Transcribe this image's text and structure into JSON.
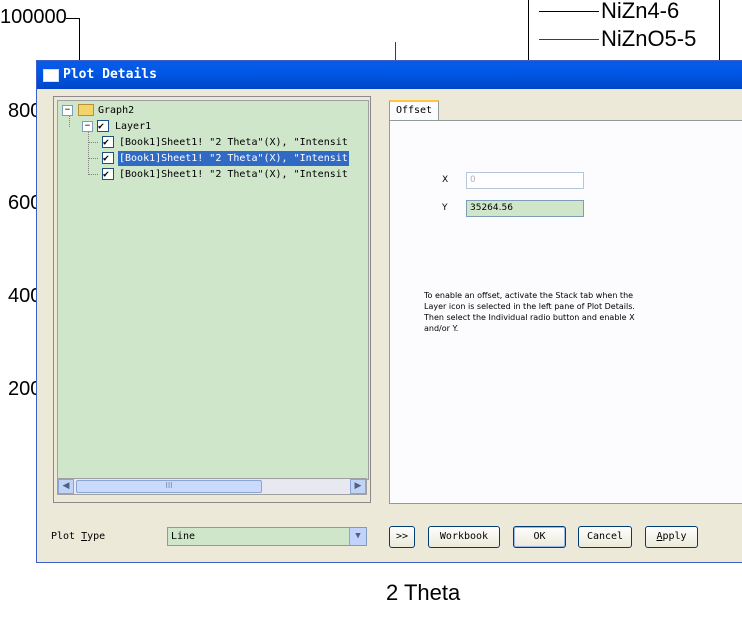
{
  "background_graph": {
    "y_tick_labels": [
      "100000",
      "800",
      "600",
      "400",
      "200"
    ],
    "x_axis_label": "2 Theta",
    "legend": [
      {
        "label": "NiZn4-6",
        "color": "#000000"
      },
      {
        "label": "NiZnO5-5",
        "color": "#cc0000"
      }
    ]
  },
  "dialog": {
    "title": "Plot Details",
    "tree": {
      "root": "Graph2",
      "layer": "Layer1",
      "items": [
        "[Book1]Sheet1! \"2 Theta\"(X), \"Intensit",
        "[Book1]Sheet1! \"2 Theta\"(X), \"Intensit",
        "[Book1]Sheet1! \"2 Theta\"(X), \"Intensit"
      ],
      "selected_index": 1,
      "scroll_thumb_text": "III"
    },
    "tab": {
      "label": "Offset",
      "x_label": "X",
      "x_value": "0",
      "y_label": "Y",
      "y_value": "35264.56",
      "hint": "To enable an offset, activate the Stack tab when the Layer icon is selected in the left pane of Plot Details.  Then select the Individual radio button and enable X and/or Y."
    },
    "plot_type_label_pre": "Plot ",
    "plot_type_label_ul": "T",
    "plot_type_label_post": "ype",
    "plot_type_value": "Line",
    "buttons": {
      "expand": ">>",
      "workbook": "Workbook",
      "ok": "OK",
      "cancel": "Cancel",
      "apply_ul": "A",
      "apply_rest": "pply"
    }
  }
}
